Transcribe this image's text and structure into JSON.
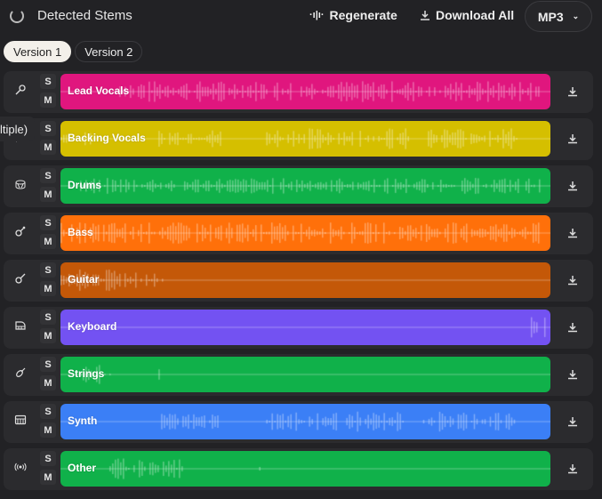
{
  "header": {
    "title": "Detected Stems",
    "regenerate": "Regenerate",
    "download_all": "Download All",
    "format": "MP3"
  },
  "tabs": [
    {
      "label": "Version 1",
      "active": true
    },
    {
      "label": "Version 2",
      "active": false
    }
  ],
  "tooltip": "ltiple)",
  "solo_label": "S",
  "mute_label": "M",
  "stems": [
    {
      "name": "Lead Vocals",
      "icon": "microphone-icon",
      "color": "#e0167e"
    },
    {
      "name": "Backing Vocals",
      "icon": "microphone-icon",
      "color": "#d5bf00"
    },
    {
      "name": "Drums",
      "icon": "drum-icon",
      "color": "#10b14a"
    },
    {
      "name": "Bass",
      "icon": "bass-guitar-icon",
      "color": "#ff700a"
    },
    {
      "name": "Guitar",
      "icon": "guitar-icon",
      "color": "#c45808"
    },
    {
      "name": "Keyboard",
      "icon": "piano-icon",
      "color": "#7352f2"
    },
    {
      "name": "Strings",
      "icon": "violin-icon",
      "color": "#10b14a"
    },
    {
      "name": "Synth",
      "icon": "synth-icon",
      "color": "#3b7ff6"
    },
    {
      "name": "Other",
      "icon": "broadcast-icon",
      "color": "#10b14a"
    }
  ]
}
